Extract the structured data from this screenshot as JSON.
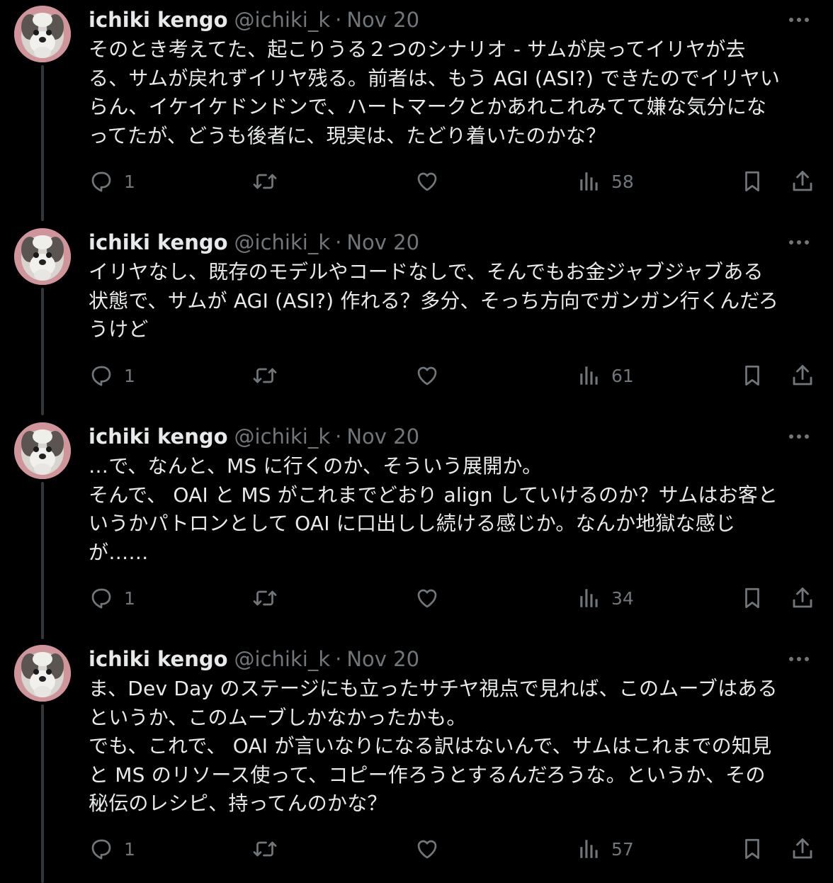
{
  "colors": {
    "background": "#000000",
    "text_primary": "#e7e9ea",
    "text_secondary": "#71767b",
    "thread_line": "#333639"
  },
  "tweets": [
    {
      "author": {
        "display_name": "ichiki kengo",
        "handle": "@ichiki_k"
      },
      "separator": "·",
      "date": "Nov 20",
      "text": "そのとき考えてた、起こりうる２つのシナリオ - サムが戻ってイリヤが去\nる、サムが戻れずイリヤ残る。前者は、もう AGI (ASI?) できたのでイリヤい\nらん、イケイケドンドンで、ハートマークとかあれこれみてて嫌な気分にな\nってたが、どうも後者に、現実は、たどり着いたのかな？",
      "replies": "1",
      "views": "58"
    },
    {
      "author": {
        "display_name": "ichiki kengo",
        "handle": "@ichiki_k"
      },
      "separator": "·",
      "date": "Nov 20",
      "text": "イリヤなし、既存のモデルやコードなしで、そんでもお金ジャブジャブある\n状態で、サムが AGI (ASI?) 作れる？多分、そっち方向でガンガン行くんだろ\nうけど",
      "replies": "1",
      "views": "61"
    },
    {
      "author": {
        "display_name": "ichiki kengo",
        "handle": "@ichiki_k"
      },
      "separator": "·",
      "date": "Nov 20",
      "text": "…で、なんと、MS に行くのか、そういう展開か。\nそんで、 OAI と MS がこれまでどおり align していけるのか？サムはお客と\nいうかパトロンとして OAI に口出しし続ける感じか。なんか地獄な感じ\nが……",
      "replies": "1",
      "views": "34"
    },
    {
      "author": {
        "display_name": "ichiki kengo",
        "handle": "@ichiki_k"
      },
      "separator": "·",
      "date": "Nov 20",
      "text": "ま、Dev Day のステージにも立ったサチヤ視点で見れば、このムーブはある\nというか、このムーブしかなかったかも。\nでも、これで、 OAI が言いなりになる訳はないんで、サムはこれまでの知見\nと MS のリソース使って、コピー作ろうとするんだろうな。というか、その\n秘伝のレシピ、持ってんのかな？",
      "replies": "1",
      "views": "57"
    }
  ],
  "icons": [
    "avatar-dog-photo",
    "more-icon",
    "reply-icon",
    "retweet-icon",
    "like-icon",
    "views-icon",
    "bookmark-icon",
    "share-icon"
  ]
}
